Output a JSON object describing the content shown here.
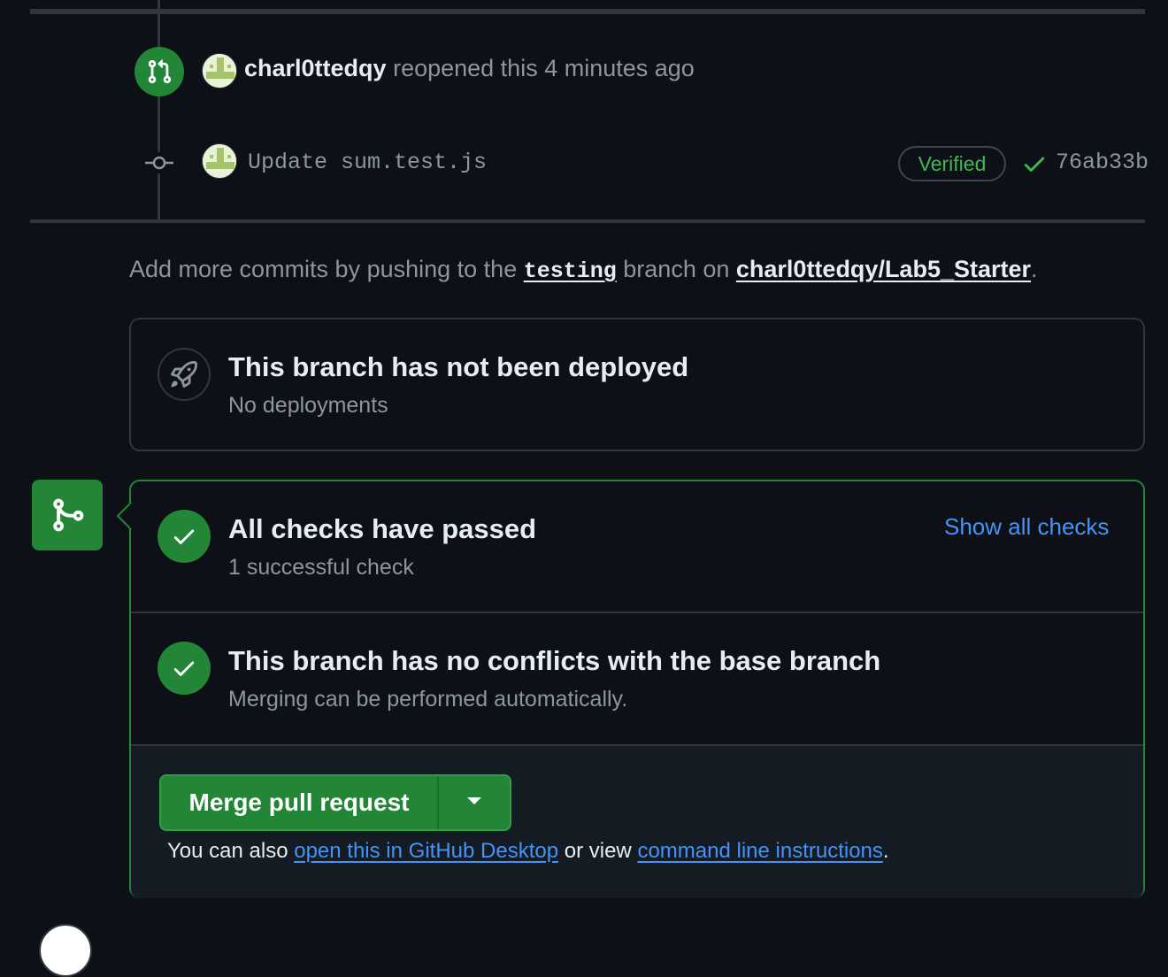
{
  "event": {
    "user": "charl0ttedqy",
    "action": "reopened this 4 minutes ago"
  },
  "commit": {
    "message": "Update sum.test.js",
    "verified_label": "Verified",
    "sha": "76ab33b"
  },
  "push_hint": {
    "prefix": "Add more commits by pushing to the",
    "branch": "testing",
    "middle": "branch on",
    "repo": "charl0ttedqy/Lab5_Starter",
    "suffix": "."
  },
  "deployment": {
    "title": "This branch has not been deployed",
    "subtitle": "No deployments"
  },
  "checks": {
    "title": "All checks have passed",
    "subtitle": "1 successful check",
    "show_all_label": "Show all checks"
  },
  "conflicts": {
    "title": "This branch has no conflicts with the base branch",
    "subtitle": "Merging can be performed automatically."
  },
  "merge": {
    "button_label": "Merge pull request",
    "also_prefix": "You can also",
    "desktop_link": "open this in GitHub Desktop",
    "or_view": "or view",
    "cli_link": "command line instructions",
    "suffix": "."
  },
  "colors": {
    "background": "#0d1117",
    "success_green": "#238636",
    "link_blue": "#4493f8",
    "muted_text": "#8d96a0",
    "border": "#30363d"
  },
  "icons": [
    "git-pull-request-icon",
    "git-commit-icon",
    "check-icon",
    "rocket-icon",
    "git-merge-icon",
    "triangle-down-icon"
  ]
}
